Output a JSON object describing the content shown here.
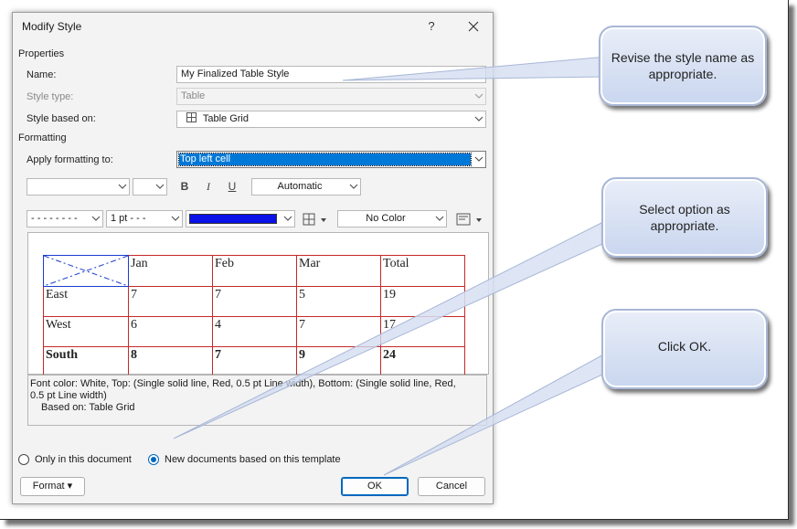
{
  "dialog": {
    "title": "Modify Style",
    "help_label": "?",
    "properties_label": "Properties",
    "name_label": "Name:",
    "name_value": "My Finalized Table Style",
    "style_type_label": "Style type:",
    "style_type_value": "Table",
    "style_based_on_label": "Style based on:",
    "style_based_on_value": "Table Grid",
    "formatting_label": "Formatting",
    "apply_formatting_label": "Apply formatting to:",
    "apply_formatting_value": "Top left cell",
    "font_name_value": "",
    "font_size_value": "",
    "bold_label": "B",
    "italic_label": "I",
    "underline_label": "U",
    "font_color_value": "Automatic",
    "line_style_value": "- - - - - - - -",
    "line_weight_value": "1 pt - - -",
    "border_color": "#0a12e8",
    "shading_value": "No Color",
    "preview_table": {
      "header": [
        "",
        "Jan",
        "Feb",
        "Mar",
        "Total"
      ],
      "rows": [
        [
          "East",
          "7",
          "7",
          "5",
          "19"
        ],
        [
          "West",
          "6",
          "4",
          "7",
          "17"
        ],
        [
          "South",
          "8",
          "7",
          "9",
          "24"
        ]
      ]
    },
    "description_line1": "Font color: White, Top: (Single solid line, Red,  0.5 pt Line width), Bottom: (Single solid line, Red,",
    "description_line2": "0.5 pt Line width)",
    "description_line3": "Based on: Table Grid",
    "radio_only_doc": "Only in this document",
    "radio_new_docs": "New documents based on this template",
    "format_button": "Format ▾",
    "ok_button": "OK",
    "cancel_button": "Cancel"
  },
  "callouts": {
    "name_tip": "Revise the style name as appropriate.",
    "option_tip": "Select option as appropriate.",
    "ok_tip": "Click OK."
  },
  "colors": {
    "selection": "#0078d7",
    "grid_border": "#c62828",
    "corner_border": "#1a3ccf",
    "accent": "#0067c0"
  }
}
